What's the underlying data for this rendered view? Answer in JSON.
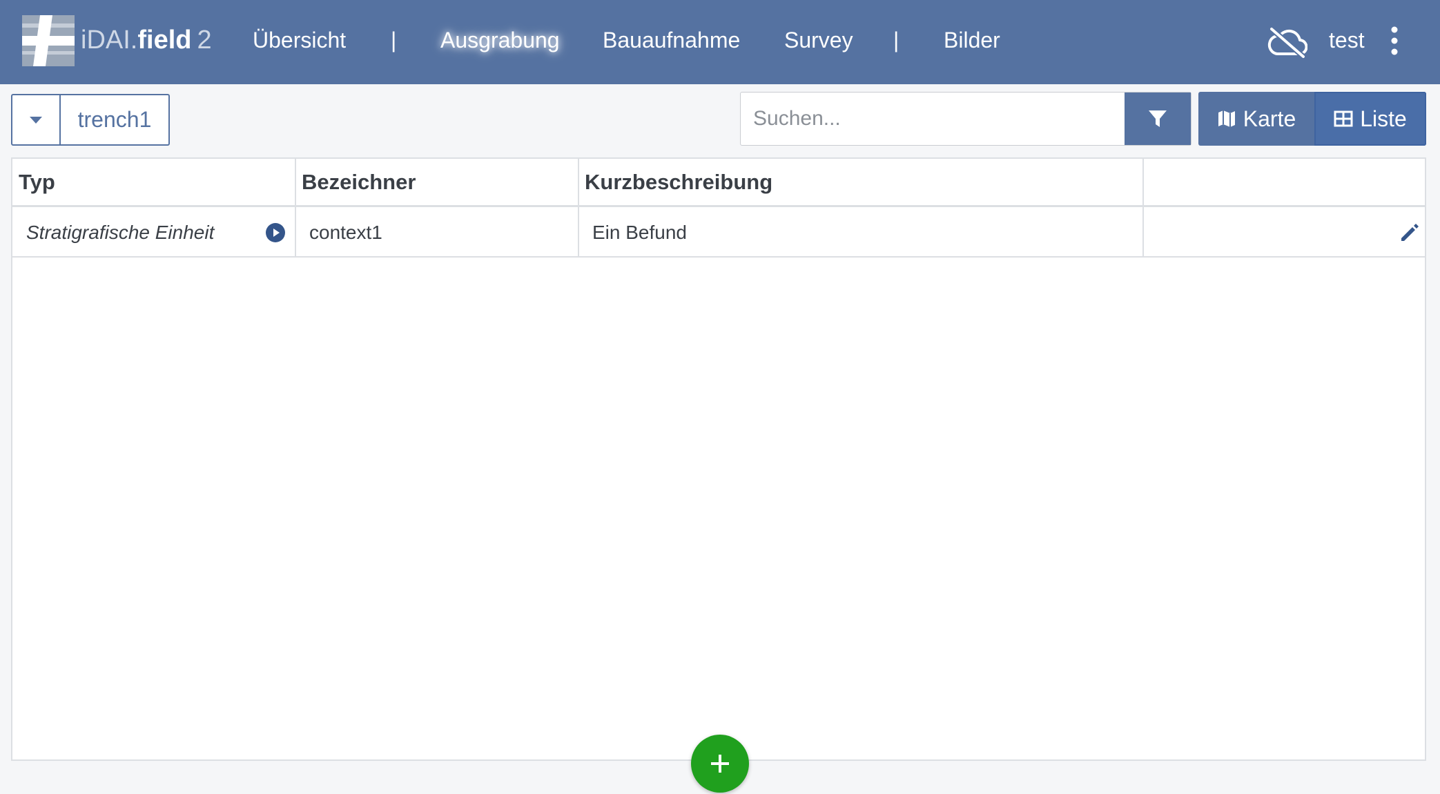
{
  "app": {
    "brand_prefix": "iDAI.",
    "brand_name": "field",
    "brand_version": "2"
  },
  "nav": {
    "items": [
      {
        "label": "Übersicht"
      },
      {
        "label": "Ausgrabung",
        "active": true
      },
      {
        "label": "Bauaufnahme"
      },
      {
        "label": "Survey"
      },
      {
        "label": "Bilder"
      }
    ],
    "separator": "|",
    "user": "test"
  },
  "toolbar": {
    "operation": "trench1",
    "search_placeholder": "Suchen...",
    "view_map_label": "Karte",
    "view_list_label": "Liste"
  },
  "table": {
    "columns": [
      "Typ",
      "Bezeichner",
      "Kurzbeschreibung",
      ""
    ],
    "rows": [
      {
        "type": "Stratigrafische Einheit",
        "identifier": "context1",
        "short_description": "Ein Befund"
      }
    ]
  },
  "colors": {
    "navbar": "#5572a1",
    "add_button": "#20a01e",
    "border": "#dcdfe3"
  },
  "icons": [
    "cloud-off-icon",
    "more-vertical-icon",
    "chevron-down-icon",
    "filter-icon",
    "map-icon",
    "table-icon",
    "play-circle-icon",
    "pencil-icon",
    "plus-icon"
  ]
}
